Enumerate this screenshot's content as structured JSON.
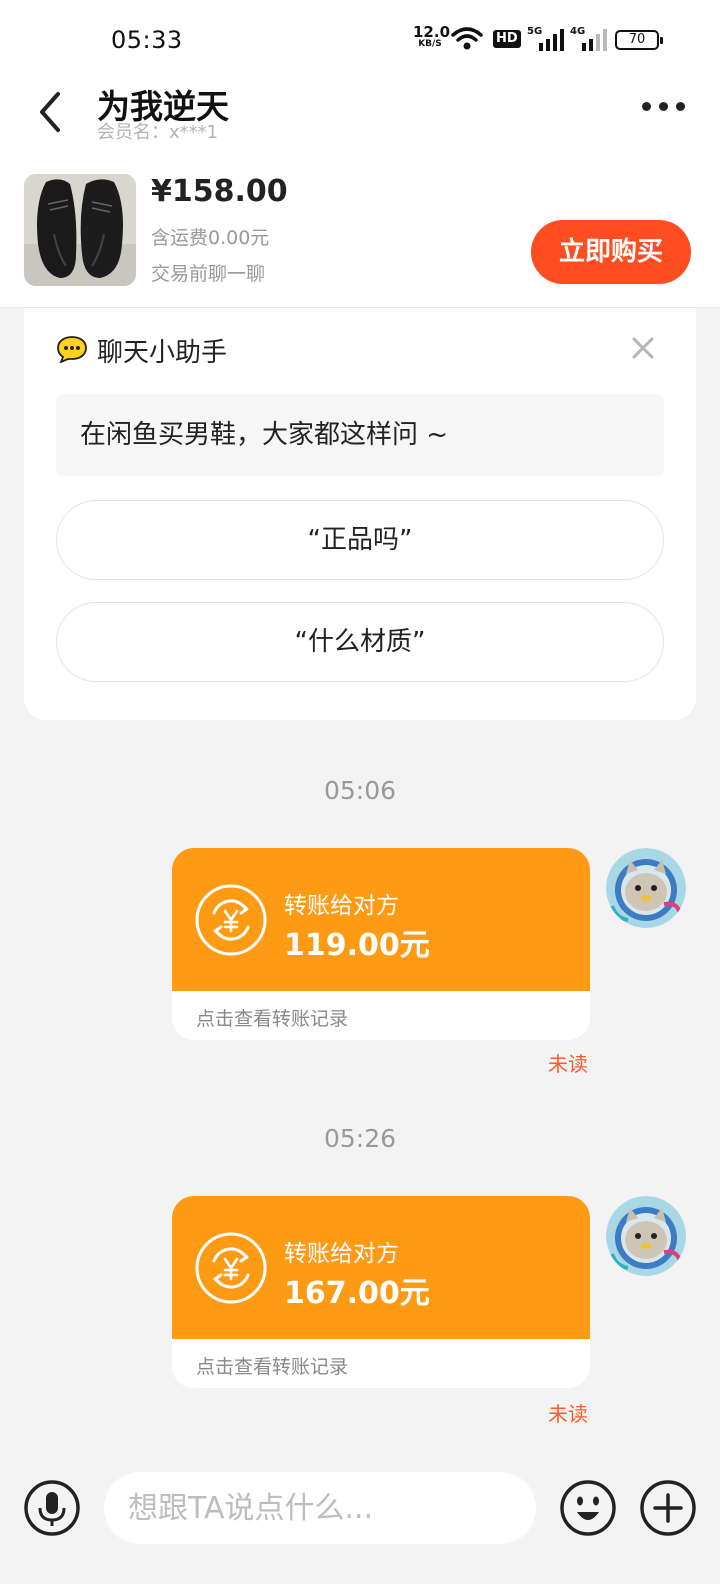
{
  "status_bar": {
    "time": "05:33",
    "net_speed_value": "12.0",
    "net_speed_unit": "KB/S",
    "hd_label": "HD",
    "sim1_gen": "5G",
    "sim2_gen": "4G",
    "battery": "70"
  },
  "header": {
    "title": "为我逆天",
    "member_label": "会员名：x***1",
    "more_icon": "more-dots-icon",
    "back_icon": "chevron-left-icon"
  },
  "product": {
    "price": "¥158.00",
    "shipping": "含运费0.00元",
    "chat_prompt": "交易前聊一聊",
    "buy_label": "立即购买",
    "buy_color": "#ff4d21"
  },
  "assistant": {
    "title": "聊天小助手",
    "hint": "在闲鱼买男鞋，大家都这样问 ~",
    "suggestions": [
      "“正品吗”",
      "“什么材质”"
    ]
  },
  "messages": [
    {
      "time": "05:06",
      "card_title": "转账给对方",
      "amount": "119.00元",
      "footer": "点击查看转账记录",
      "status": "未读"
    },
    {
      "time": "05:26",
      "card_title": "转账给对方",
      "amount": "167.00元",
      "footer": "点击查看转账记录",
      "status": "未读"
    }
  ],
  "composer": {
    "placeholder": "想跟TA说点什么...",
    "mic_icon": "microphone-icon",
    "emoji_icon": "emoji-icon",
    "plus_icon": "plus-icon"
  },
  "colors": {
    "transfer_card": "#ff9a14",
    "unread": "#ff5a26",
    "background": "#f3f3f3"
  }
}
